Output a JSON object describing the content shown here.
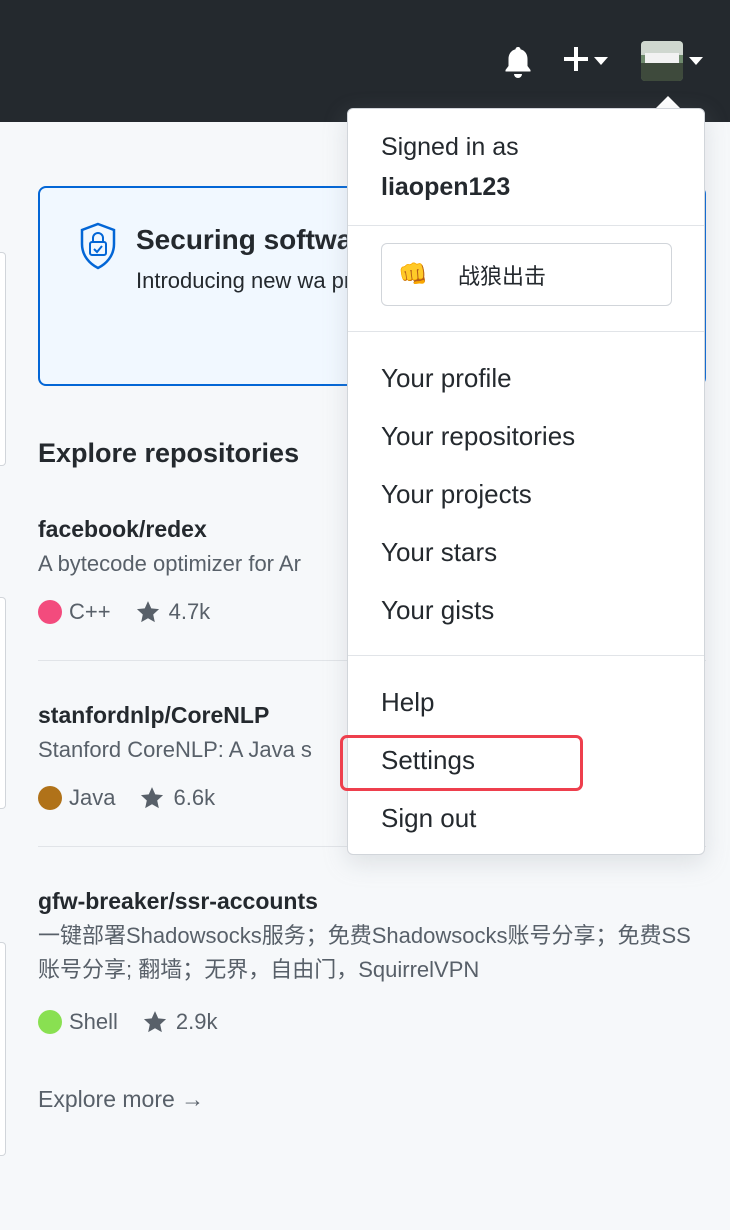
{
  "header": {
    "notifications_icon": "bell-icon",
    "create_icon": "plus-icon",
    "avatar_icon": "user-avatar"
  },
  "banner": {
    "title": "Securing softwa",
    "description": "Introducing new wa prevent security vu code base."
  },
  "explore": {
    "title": "Explore repositories",
    "repos": [
      {
        "name": "facebook/redex",
        "description": "A bytecode optimizer for Ar",
        "language": "C++",
        "language_color": "#f34b7d",
        "stars": "4.7k"
      },
      {
        "name": "stanfordnlp/CoreNLP",
        "description": "Stanford CoreNLP: A Java s",
        "language": "Java",
        "language_color": "#b07219",
        "stars": "6.6k"
      },
      {
        "name": "gfw-breaker/ssr-accounts",
        "description": "一键部署Shadowsocks服务；免费Shadowsocks账号分享；免费SS账号分享; 翻墙；无界，自由门，SquirrelVPN",
        "language": "Shell",
        "language_color": "#89e051",
        "stars": "2.9k"
      }
    ],
    "more_label": "Explore more →"
  },
  "user_menu": {
    "signed_in_label": "Signed in as",
    "username": "liaopen123",
    "status_emoji": "👊",
    "status_text": "战狼出击",
    "items": [
      "Your profile",
      "Your repositories",
      "Your projects",
      "Your stars",
      "Your gists"
    ],
    "help": "Help",
    "settings": "Settings",
    "sign_out": "Sign out"
  }
}
